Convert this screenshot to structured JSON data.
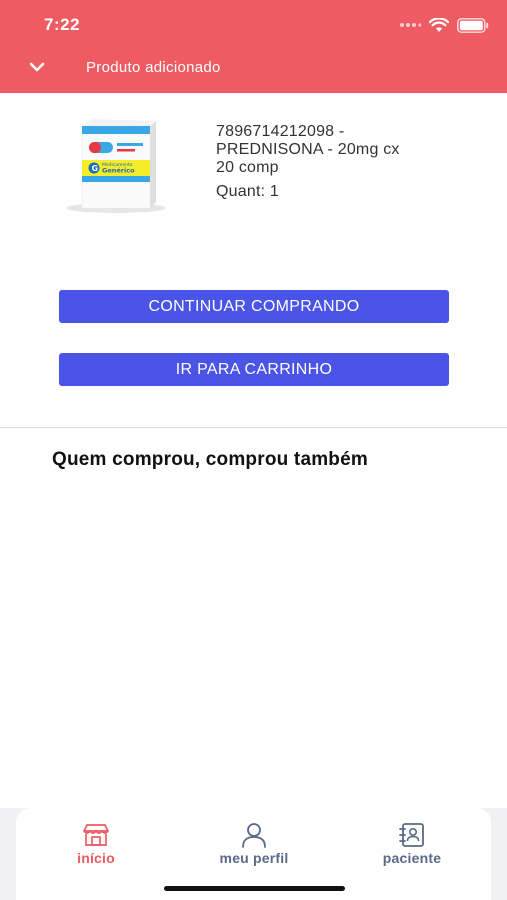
{
  "status_bar": {
    "time": "7:22",
    "icons": [
      "signal-dots-icon",
      "wifi-icon",
      "battery-icon"
    ]
  },
  "header": {
    "title": "Produto adicionado",
    "back_icon": "chevron-down-icon",
    "background_color": "#ee5b63"
  },
  "product": {
    "line1": "7896714212098 -",
    "line2": "PREDNISONA - 20mg cx",
    "line3": "20 comp",
    "quantity": "Quant: 1",
    "box_brand": "Medicamento Genérico",
    "box_letter": "G"
  },
  "actions": {
    "continue_label": "CONTINUAR COMPRANDO",
    "cart_label": "IR PARA CARRINHO",
    "button_color": "#4a54e6"
  },
  "related": {
    "title": "Quem comprou, comprou também"
  },
  "tabbar": {
    "items": [
      {
        "label": "início",
        "icon": "store-icon",
        "active": true
      },
      {
        "label": "meu perfil",
        "icon": "user-icon",
        "active": false
      },
      {
        "label": "paciente",
        "icon": "contact-book-icon",
        "active": false
      }
    ],
    "active_color": "#ee5b63",
    "inactive_color": "#5a6a86"
  }
}
